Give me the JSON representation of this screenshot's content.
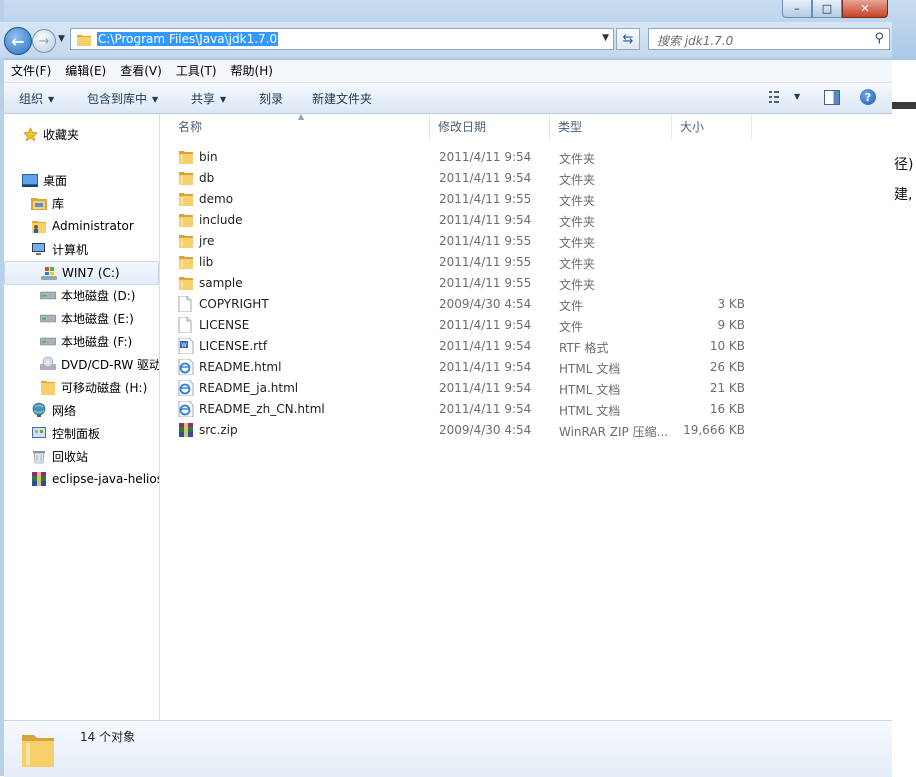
{
  "window": {
    "caption_minimize": "–",
    "caption_maximize": "□",
    "caption_close": "✕"
  },
  "address_bar": {
    "path": "C:\\Program Files\\Java\\jdk1.7.0"
  },
  "search": {
    "placeholder": "搜索 jdk1.7.0"
  },
  "menu": [
    "文件(F)",
    "编辑(E)",
    "查看(V)",
    "工具(T)",
    "帮助(H)"
  ],
  "toolbar": {
    "organize": "组织",
    "include_in_library": "包含到库中",
    "share": "共享",
    "burn": "刻录",
    "new_folder": "新建文件夹"
  },
  "nav": {
    "favorites": "收藏夹",
    "desktop": "桌面",
    "libraries": "库",
    "user": "Administrator",
    "computer": "计算机",
    "drive_c": "WIN7 (C:)",
    "drive_d": "本地磁盘 (D:)",
    "drive_e": "本地磁盘 (E:)",
    "drive_f": "本地磁盘 (F:)",
    "dvd": "DVD/CD-RW 驱动",
    "removable": "可移动磁盘 (H:)",
    "network": "网络",
    "control_panel": "控制面板",
    "recycle_bin": "回收站",
    "eclipse": "eclipse-java-helios"
  },
  "columns": {
    "name": "名称",
    "modified": "修改日期",
    "type": "类型",
    "size": "大小"
  },
  "files": [
    {
      "name": "bin",
      "date": "2011/4/11 9:54",
      "type": "文件夹",
      "size": "",
      "icon": "folder"
    },
    {
      "name": "db",
      "date": "2011/4/11 9:54",
      "type": "文件夹",
      "size": "",
      "icon": "folder"
    },
    {
      "name": "demo",
      "date": "2011/4/11 9:55",
      "type": "文件夹",
      "size": "",
      "icon": "folder"
    },
    {
      "name": "include",
      "date": "2011/4/11 9:54",
      "type": "文件夹",
      "size": "",
      "icon": "folder"
    },
    {
      "name": "jre",
      "date": "2011/4/11 9:55",
      "type": "文件夹",
      "size": "",
      "icon": "folder"
    },
    {
      "name": "lib",
      "date": "2011/4/11 9:55",
      "type": "文件夹",
      "size": "",
      "icon": "folder"
    },
    {
      "name": "sample",
      "date": "2011/4/11 9:55",
      "type": "文件夹",
      "size": "",
      "icon": "folder"
    },
    {
      "name": "COPYRIGHT",
      "date": "2009/4/30 4:54",
      "type": "文件",
      "size": "3 KB",
      "icon": "file"
    },
    {
      "name": "LICENSE",
      "date": "2011/4/11 9:54",
      "type": "文件",
      "size": "9 KB",
      "icon": "file"
    },
    {
      "name": "LICENSE.rtf",
      "date": "2011/4/11 9:54",
      "type": "RTF 格式",
      "size": "10 KB",
      "icon": "rtf"
    },
    {
      "name": "README.html",
      "date": "2011/4/11 9:54",
      "type": "HTML 文档",
      "size": "26 KB",
      "icon": "html"
    },
    {
      "name": "README_ja.html",
      "date": "2011/4/11 9:54",
      "type": "HTML 文档",
      "size": "21 KB",
      "icon": "html"
    },
    {
      "name": "README_zh_CN.html",
      "date": "2011/4/11 9:54",
      "type": "HTML 文档",
      "size": "16 KB",
      "icon": "html"
    },
    {
      "name": "src.zip",
      "date": "2009/4/30 4:54",
      "type": "WinRAR ZIP 压缩...",
      "size": "19,666 KB",
      "icon": "zip"
    }
  ],
  "details": {
    "count": "14 个对象"
  },
  "background": {
    "frag1": "径)",
    "frag2": "建,"
  },
  "colors": {
    "accent": "#3399ff",
    "folder": "#f2c94c"
  }
}
